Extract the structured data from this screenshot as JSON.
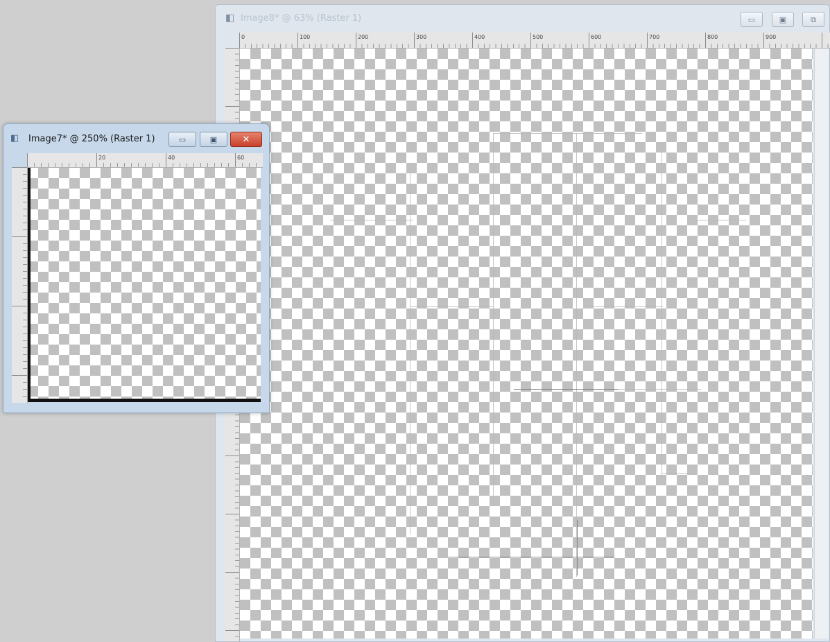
{
  "window_back": {
    "title": "Image8* @ 63% (Raster 1)",
    "icon": "image-doc-icon",
    "controls": {
      "minimize": "▭",
      "maximize": "▣",
      "restore": "⧉"
    },
    "ruler_top_labels": [
      "0",
      "100",
      "200",
      "300",
      "400",
      "500",
      "600",
      "700",
      "800",
      "900"
    ]
  },
  "window_front": {
    "title": "Image7* @ 250% (Raster 1)",
    "icon": "image-doc-icon",
    "controls": {
      "minimize": "▭",
      "maximize": "▣",
      "close": "✕"
    },
    "ruler_top_labels": [
      "",
      "20",
      "40",
      "60"
    ]
  },
  "colors": {
    "desktop_bg": "#cfcfcf",
    "checker_dark": "#c0c0c0",
    "checker_light": "#ffffff",
    "active_frame": "#c6d8ea",
    "close_button": "#c7412a"
  }
}
